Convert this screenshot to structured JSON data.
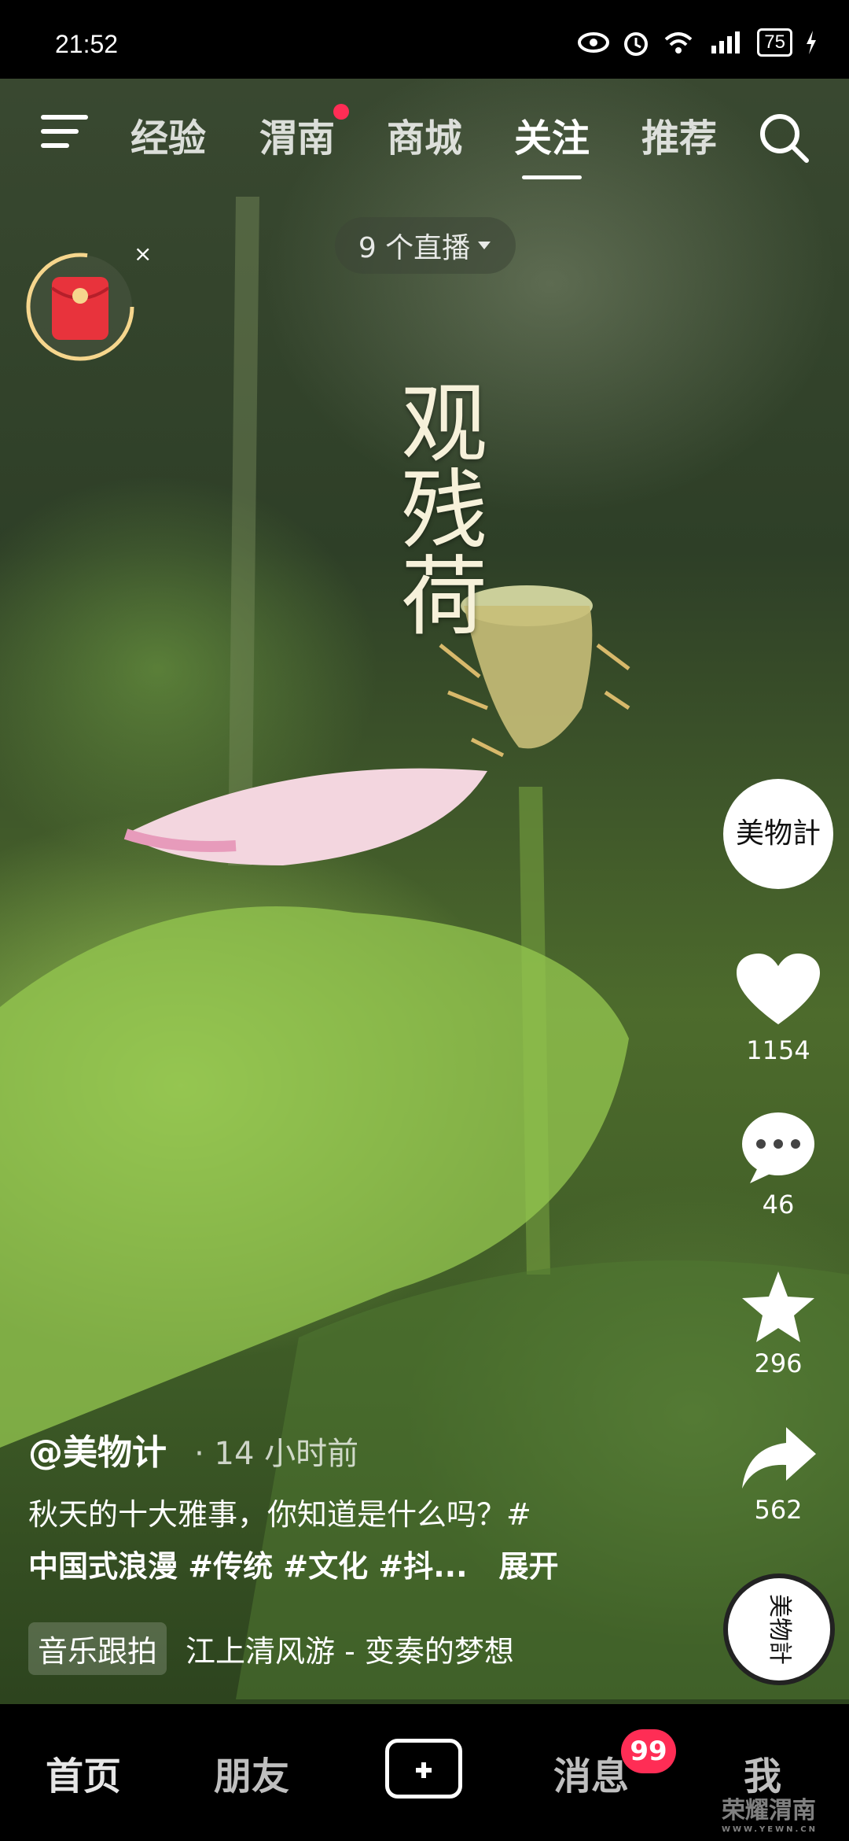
{
  "status_bar": {
    "time": "21:52",
    "battery": "75"
  },
  "top_nav": {
    "tabs": [
      {
        "label": "经验"
      },
      {
        "label": "渭南"
      },
      {
        "label": "商城"
      },
      {
        "label": "关注"
      },
      {
        "label": "推荐"
      }
    ],
    "active_tab": "关注"
  },
  "live_pill": {
    "label": "9 个直播"
  },
  "video": {
    "overlay_title": "观残荷",
    "author": "@美物计",
    "time_ago": "· 14 小时前",
    "description_line1": "秋天的十大雅事，你知道是什么吗？#",
    "hashtags": "中国式浪漫 #传统 #文化 #抖...",
    "expand_label": "展开",
    "music_tag": "音乐跟拍",
    "music_title": "江上清风游 - 变奏的梦想"
  },
  "right_bar": {
    "avatar_text": "美物計",
    "likes": "1154",
    "comments": "46",
    "favorites": "296",
    "shares": "562",
    "disc_text": "美物計"
  },
  "bottom_nav": {
    "items": [
      {
        "label": "首页"
      },
      {
        "label": "朋友"
      },
      {
        "label": "消息"
      },
      {
        "label": "我"
      }
    ],
    "messages_badge": "99"
  },
  "watermark": {
    "text": "荣耀渭南",
    "sub": "WWW.YEWN.CN"
  },
  "colors": {
    "accent": "#ff2d55",
    "text": "#ffffff"
  }
}
